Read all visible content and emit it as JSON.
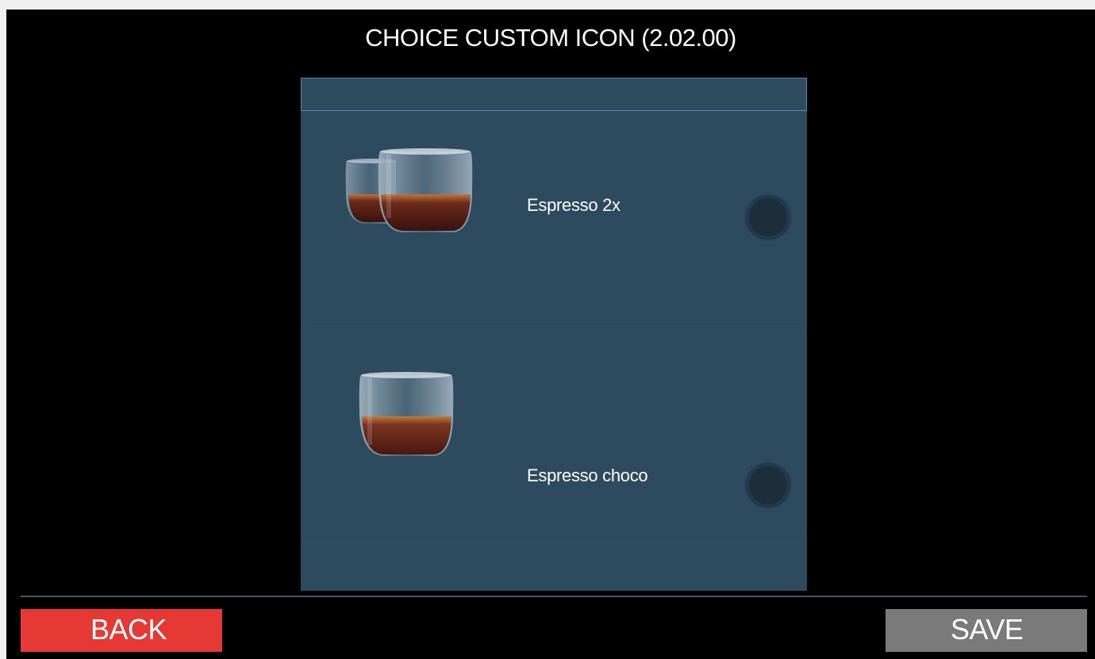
{
  "header": {
    "title": "CHOICE CUSTOM ICON (2.02.00)"
  },
  "list": {
    "items": [
      {
        "label": "Espresso 2x",
        "icon": "double-espresso-glass-icon",
        "selected": false
      },
      {
        "label": "Espresso choco",
        "icon": "espresso-glass-icon",
        "selected": false
      }
    ]
  },
  "footer": {
    "back_label": "BACK",
    "save_label": "SAVE"
  },
  "colors": {
    "back": "#e63935",
    "save": "#7a7a7a",
    "panel": "#2d4a5f",
    "background": "#000000"
  }
}
